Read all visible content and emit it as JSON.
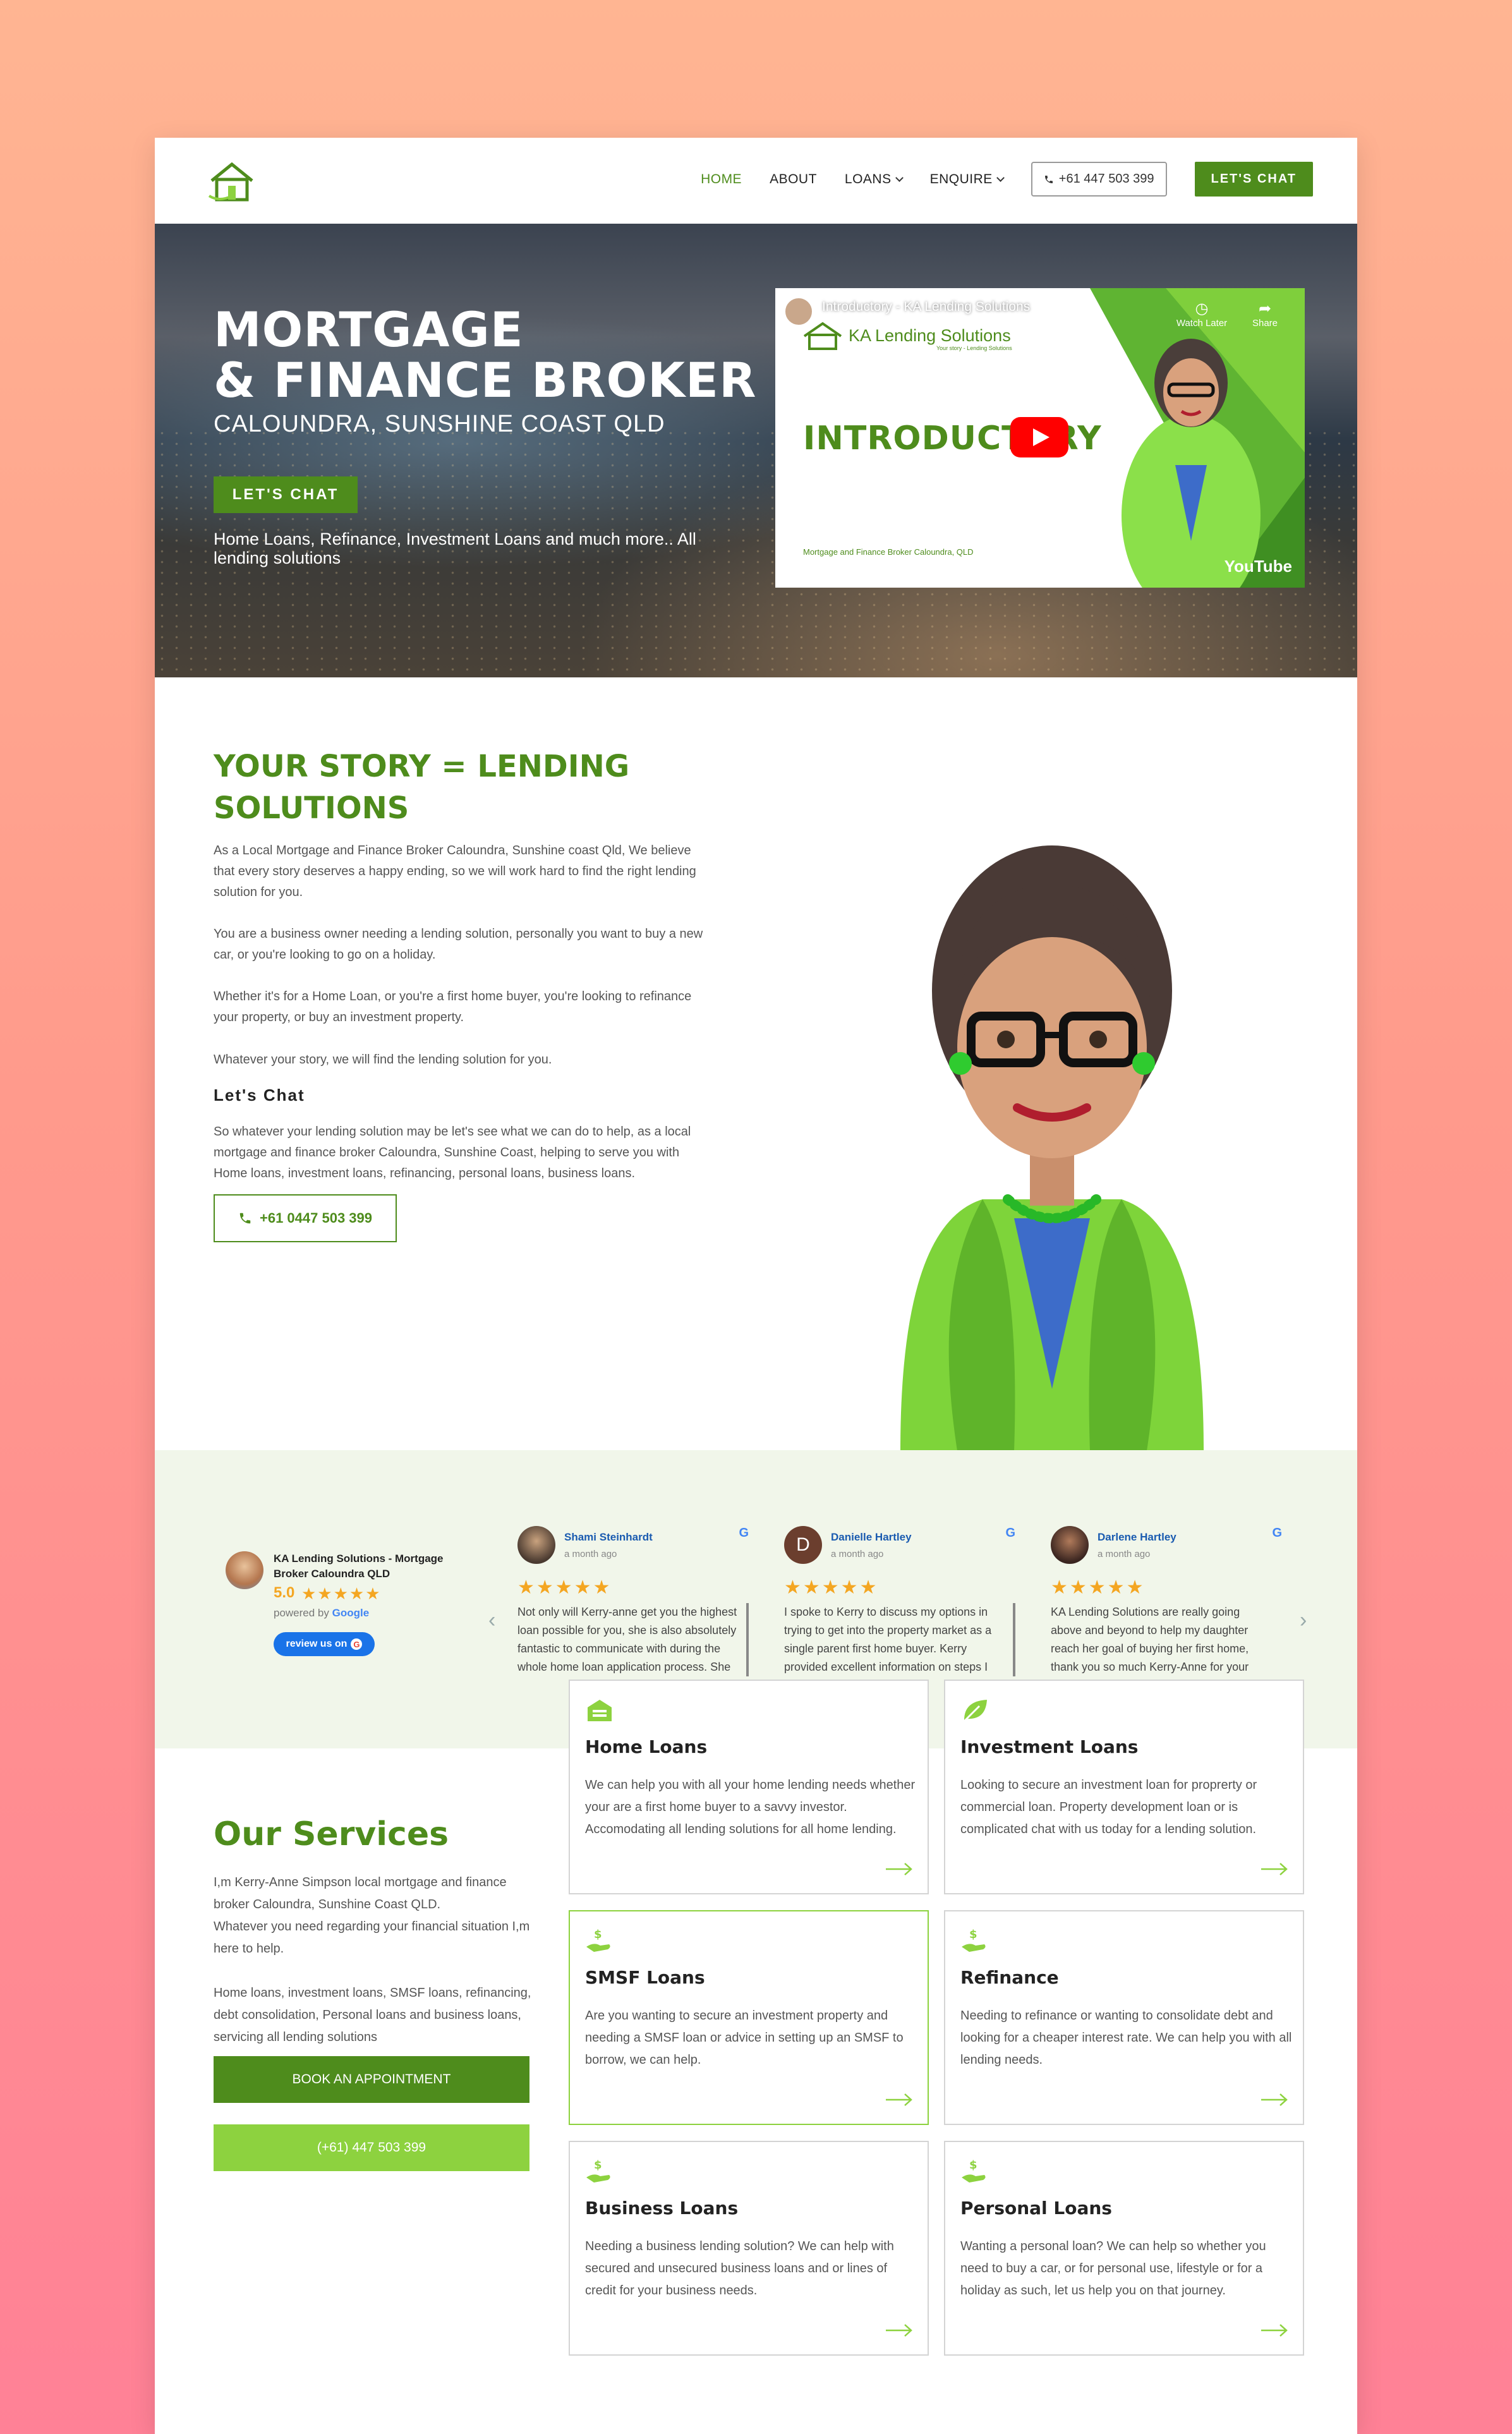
{
  "nav": {
    "items": [
      {
        "label": "HOME",
        "active": true
      },
      {
        "label": "ABOUT",
        "active": false
      },
      {
        "label": "LOANS",
        "dropdown": true
      },
      {
        "label": "ENQUIRE",
        "dropdown": true
      }
    ],
    "phone": "+61 447 503 399",
    "chat": "LET'S CHAT"
  },
  "hero": {
    "title_line1": "MORTGAGE",
    "title_line2": "& FINANCE BROKER",
    "subtitle": "CALOUNDRA, SUNSHINE COAST QLD",
    "button": "LET'S CHAT",
    "tagline": "Home Loans, Refinance, Investment Loans and much more.. All lending solutions",
    "video": {
      "title": "Introductory - KA Lending Solutions",
      "brand": "KA Lending Solutions",
      "brand_sub": "Your story - Lending Solutions",
      "heading": "INTRODUCTORY",
      "caption": "Mortgage and Finance Broker Caloundra, QLD",
      "watch_later": "Watch Later",
      "share": "Share",
      "platform": "YouTube"
    }
  },
  "story": {
    "heading": "YOUR STORY = LENDING SOLUTIONS",
    "p1": "As a Local Mortgage and Finance Broker Caloundra, Sunshine coast Qld, We believe that every story deserves a happy ending, so we will work hard to find the right lending solution for you.",
    "p2": "You are a business owner needing a lending solution, personally you want to buy a new car, or you're looking to go on a holiday.",
    "p3": "Whether it's for a Home Loan, or you're a first home buyer, you're looking to refinance your property, or buy an investment property.",
    "p4": "Whatever your story, we will find the lending solution for you.",
    "subheading": "Let's Chat",
    "p5": "So whatever your lending solution may be let's see what we can do to help, as a local mortgage and finance broker Caloundra, Sunshine Coast, helping to serve you with Home loans, investment loans, refinancing, personal loans, business loans.",
    "phone": "+61 0447 503 399"
  },
  "reviews": {
    "business": "KA Lending Solutions - Mortgage Broker Caloundra QLD",
    "rating": "5.0",
    "stars": "★★★★★",
    "powered_by": "powered by",
    "google": "Google",
    "review_button": "review us on",
    "items": [
      {
        "name": "Shami Steinhardt",
        "time": "a month ago",
        "text": "Not only will Kerry-anne get you the highest loan possible for you, she is also absolutely fantastic to communicate with during the whole home loan application process. She"
      },
      {
        "name": "Danielle Hartley",
        "time": "a month ago",
        "initial": "D",
        "text": "I spoke to Kerry to discuss my options in trying to get into the property market as a single parent first home buyer. Kerry provided excellent information on steps I"
      },
      {
        "name": "Darlene Hartley",
        "time": "a month ago",
        "text": "KA Lending Solutions are really going above and beyond to help my daughter reach her goal of buying her first home, thank you so much Kerry-Anne for your help."
      }
    ]
  },
  "services": {
    "heading": "Our Services",
    "p1": "I,m Kerry-Anne Simpson local mortgage and finance broker Caloundra, Sunshine Coast QLD.",
    "p2": "Whatever you need regarding your financial situation I,m here to help.",
    "p3": "Home loans, investment loans, SMSF loans, refinancing, debt consolidation, Personal loans and business loans, servicing all lending solutions",
    "book_button": "BOOK AN APPOINTMENT",
    "phone_button": "(+61) 447 503 399",
    "cards": [
      {
        "title": "Home Loans",
        "text": "We can help you with all your home lending needs whether your are a first home buyer to a savvy investor. Accomodating all lending solutions for all home lending."
      },
      {
        "title": "Investment Loans",
        "text": "Looking to secure an investment loan for proprerty or commercial loan. Property development loan or is complicated chat with us today for a lending solution."
      },
      {
        "title": "SMSF Loans",
        "text": "Are you wanting to secure an investment property and needing a SMSF loan or advice in setting up an SMSF to borrow, we can help."
      },
      {
        "title": "Refinance",
        "text": "Needing to refinance or wanting to consolidate debt and looking for a cheaper interest rate. We can help you with all lending needs."
      },
      {
        "title": "Business Loans",
        "text": "Needing a business lending solution? We can help with secured and unsecured business loans and or lines of credit for your business needs."
      },
      {
        "title": "Personal Loans",
        "text": "Wanting a personal loan? We can help so whether you need to buy a car, or for personal use, lifestyle or for a holiday as such, let us help you on that journey."
      }
    ]
  },
  "colors": {
    "brand_green": "#4e8c1c",
    "light_green": "#8dd23f",
    "review_bg": "#f1f6ea",
    "star": "#f4a622"
  }
}
